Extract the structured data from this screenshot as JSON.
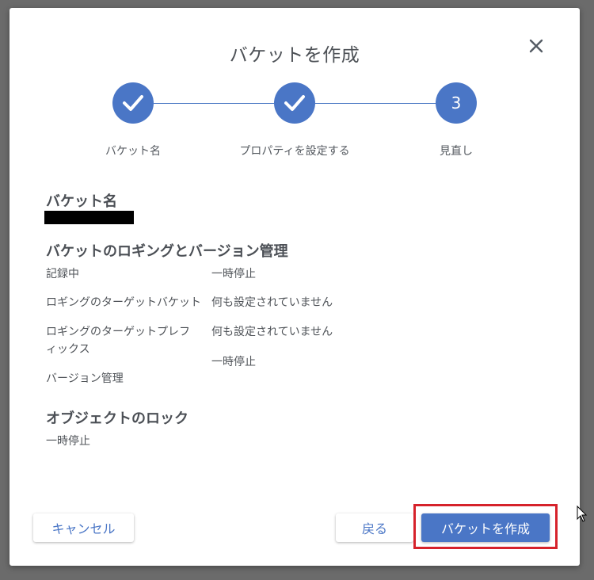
{
  "dialog": {
    "title": "バケットを作成",
    "close_icon": "close-icon"
  },
  "stepper": {
    "accent_color": "#4a76c6",
    "steps": [
      {
        "label": "バケット名",
        "state": "complete",
        "icon": "check-icon"
      },
      {
        "label": "プロパティを設定する",
        "state": "complete",
        "icon": "check-icon"
      },
      {
        "label": "見直し",
        "state": "current",
        "number": "3"
      }
    ]
  },
  "review": {
    "bucket_name_title": "バケット名",
    "logging_title": "バケットのロギングとバージョン管理",
    "rows": [
      {
        "label": "記録中",
        "value": "一時停止"
      },
      {
        "label": "ロギングのターゲットバケット",
        "value": "何も設定されていません"
      },
      {
        "label": "ロギングのターゲットプレフィックス",
        "value": "何も設定されていません"
      },
      {
        "label": "バージョン管理",
        "value": "一時停止"
      }
    ],
    "object_lock_title": "オブジェクトのロック",
    "object_lock_value": "一時停止"
  },
  "footer": {
    "cancel_label": "キャンセル",
    "back_label": "戻る",
    "create_label": "バケットを作成",
    "highlight_color": "#d6222b"
  }
}
